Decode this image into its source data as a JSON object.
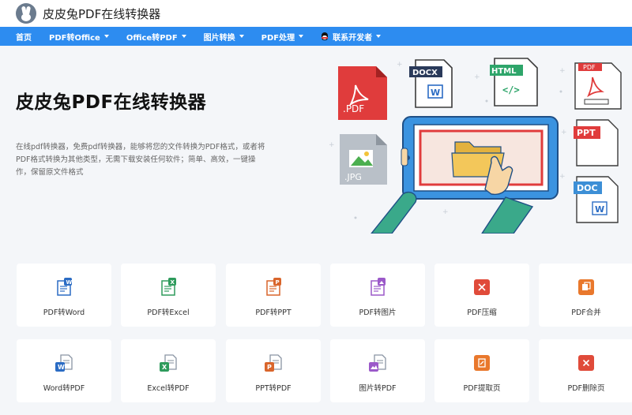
{
  "header": {
    "title": "皮皮兔PDF在线转换器",
    "logo_icon": "rabbit-logo-icon"
  },
  "nav": {
    "items": [
      {
        "label": "首页",
        "dropdown": false
      },
      {
        "label": "PDF转Office",
        "dropdown": true
      },
      {
        "label": "Office转PDF",
        "dropdown": true
      },
      {
        "label": "图片转换",
        "dropdown": true
      },
      {
        "label": "PDF处理",
        "dropdown": true
      },
      {
        "label": "联系开发者",
        "dropdown": true,
        "icon": "qq-icon"
      }
    ]
  },
  "hero": {
    "title": "皮皮兔PDF在线转换器",
    "description": "在线pdf转换器，免费pdf转换器，能够将您的文件转换为PDF格式，或者将PDF格式转换为其他类型，无需下载安装任何软件；简单、高效，一键操作，保留原文件格式",
    "file_labels": {
      "pdf": ".PDF",
      "docx": "DOCX",
      "html": "HTML",
      "html_tag": "</>",
      "pdf2": "PDF",
      "ppt": "PPT",
      "doc": "DOC",
      "jpg": ".JPG",
      "w": "W"
    }
  },
  "tools": [
    {
      "label": "PDF转Word",
      "icon": "pdf-to-word-icon",
      "bg": "#eef5fc",
      "color": "#2b6cc4",
      "letter": "W"
    },
    {
      "label": "PDF转Excel",
      "icon": "pdf-to-excel-icon",
      "bg": "#eef8f2",
      "color": "#2e9b5c",
      "letter": "X"
    },
    {
      "label": "PDF转PPT",
      "icon": "pdf-to-ppt-icon",
      "bg": "#fcf6ef",
      "color": "#d9652b",
      "letter": "P"
    },
    {
      "label": "PDF转图片",
      "icon": "pdf-to-image-icon",
      "bg": "#f6f0fb",
      "color": "#9b59c9",
      "letter": ""
    },
    {
      "label": "PDF压缩",
      "icon": "pdf-compress-icon",
      "bg": "#f8f1f1",
      "color": "#e04b3a",
      "letter": ""
    },
    {
      "label": "PDF合并",
      "icon": "pdf-merge-icon",
      "bg": "#fcf4ee",
      "color": "#e9782c",
      "letter": ""
    },
    {
      "label": "Word转PDF",
      "icon": "word-to-pdf-icon",
      "bg": "#eef5fc",
      "color": "#2b6cc4",
      "letter": "W"
    },
    {
      "label": "Excel转PDF",
      "icon": "excel-to-pdf-icon",
      "bg": "#eef8f2",
      "color": "#2e9b5c",
      "letter": "X"
    },
    {
      "label": "PPT转PDF",
      "icon": "ppt-to-pdf-icon",
      "bg": "#fcf6ef",
      "color": "#d9652b",
      "letter": "P"
    },
    {
      "label": "图片转PDF",
      "icon": "image-to-pdf-icon",
      "bg": "#f6f0fb",
      "color": "#9b59c9",
      "letter": ""
    },
    {
      "label": "PDF提取页",
      "icon": "pdf-extract-icon",
      "bg": "#fcf4ee",
      "color": "#e9782c",
      "letter": ""
    },
    {
      "label": "PDF删除页",
      "icon": "pdf-delete-icon",
      "bg": "#f8f1f1",
      "color": "#e04b3a",
      "letter": ""
    }
  ]
}
